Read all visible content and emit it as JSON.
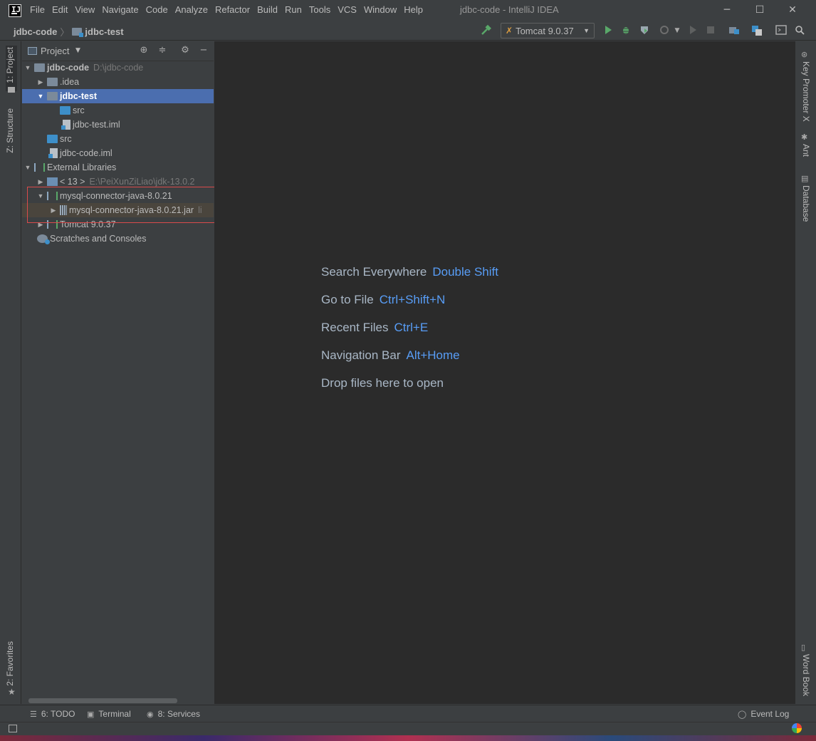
{
  "window": {
    "title": "jdbc-code - IntelliJ IDEA",
    "logo_text": "IJ",
    "controls": {
      "minimize": "─",
      "maximize": "☐",
      "close": "✕"
    }
  },
  "menu": [
    "File",
    "Edit",
    "View",
    "Navigate",
    "Code",
    "Analyze",
    "Refactor",
    "Build",
    "Run",
    "Tools",
    "VCS",
    "Window",
    "Help"
  ],
  "breadcrumb": {
    "project": "jdbc-code",
    "module": "jdbc-test",
    "separator": "〉"
  },
  "toolbar": {
    "run_config": "Tomcat 9.0.37",
    "icons": [
      "hammer-icon",
      "run-icon",
      "debug-icon",
      "coverage-icon",
      "profile-icon",
      "rerun-icon",
      "stop-icon",
      "project-structure-icon",
      "translate-icon",
      "terminal-icon",
      "search-icon"
    ]
  },
  "left_tabs": {
    "project": "1: Project",
    "structure": "Z: Structure",
    "favorites": "2: Favorites"
  },
  "right_tabs": {
    "key_promoter": "Key Promoter X",
    "ant": "Ant",
    "database": "Database",
    "word_book": "Word Book"
  },
  "project_panel": {
    "title": "Project",
    "tree": [
      {
        "label": "jdbc-code",
        "path": "D:\\jdbc-code",
        "bold": true
      },
      {
        "label": ".idea"
      },
      {
        "label": "jdbc-test",
        "selected": true
      },
      {
        "label": "src"
      },
      {
        "label": "jdbc-test.iml"
      },
      {
        "label": "src"
      },
      {
        "label": "jdbc-code.iml"
      },
      {
        "label": "External Libraries"
      },
      {
        "label": "< 13 >",
        "path": "E:\\PeiXunZiLiao\\jdk-13.0.2"
      },
      {
        "label": "mysql-connector-java-8.0.21"
      },
      {
        "label": "mysql-connector-java-8.0.21.jar",
        "suffix": "li"
      },
      {
        "label": "Tomcat 9.0.37"
      },
      {
        "label": "Scratches and Consoles"
      }
    ]
  },
  "editor": {
    "hints": [
      {
        "label": "Search Everywhere",
        "shortcut": "Double Shift"
      },
      {
        "label": "Go to File",
        "shortcut": "Ctrl+Shift+N"
      },
      {
        "label": "Recent Files",
        "shortcut": "Ctrl+E"
      },
      {
        "label": "Navigation Bar",
        "shortcut": "Alt+Home"
      },
      {
        "label": "Drop files here to open",
        "shortcut": ""
      }
    ]
  },
  "bottom_tabs": {
    "todo": "6: TODO",
    "terminal": "Terminal",
    "services": "8: Services",
    "event_log": "Event Log"
  },
  "colors": {
    "selection": "#4b6eaf",
    "shortcut": "#589df6",
    "highlight_box": "#d94b4b",
    "editor_bg": "#2b2b2b"
  }
}
